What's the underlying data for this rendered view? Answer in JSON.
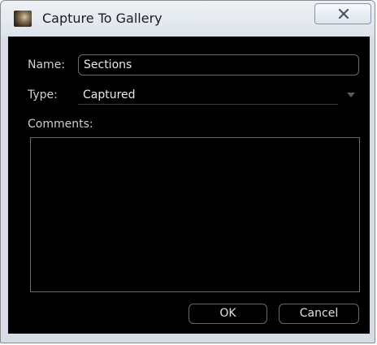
{
  "window": {
    "title": "Capture To Gallery",
    "icon": "app-photo-icon",
    "close_glyph": "X"
  },
  "form": {
    "name_label": "Name:",
    "name_value": "Sections",
    "type_label": "Type:",
    "type_value": "Captured",
    "comments_label": "Comments:",
    "comments_value": ""
  },
  "buttons": {
    "ok_label": "OK",
    "cancel_label": "Cancel"
  },
  "colors": {
    "panel_background": "#000000",
    "chrome_background": "#d7dde6",
    "text": "#e8e8e8"
  }
}
